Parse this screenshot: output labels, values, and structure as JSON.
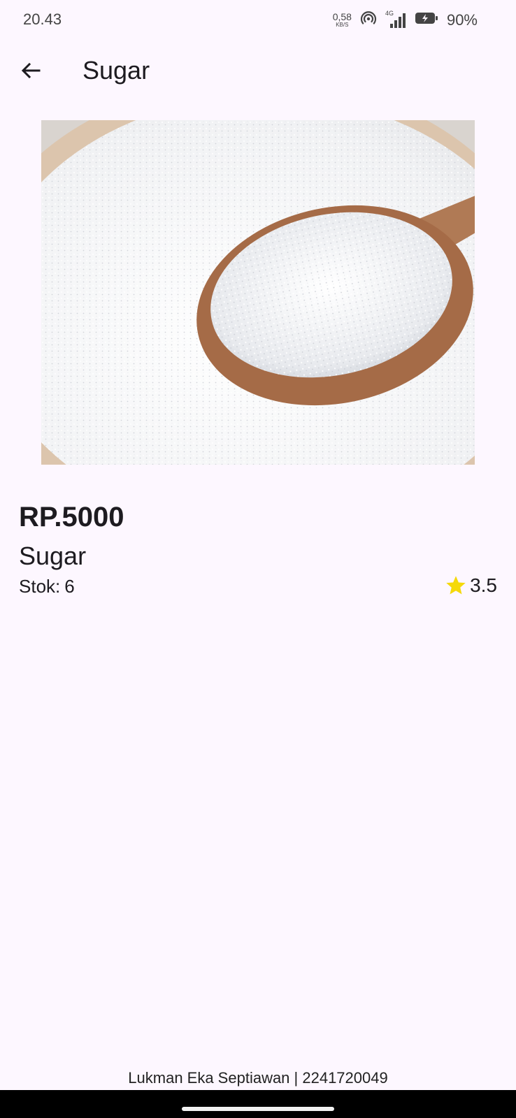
{
  "status_bar": {
    "time": "20.43",
    "net_speed_value": "0,58",
    "net_speed_unit": "KB/S",
    "network_type": "4G",
    "battery_percent": "90%"
  },
  "app_bar": {
    "title": "Sugar",
    "back_icon": "arrow-back-icon"
  },
  "product": {
    "image_alt": "sugar-photo",
    "price": "RP.5000",
    "name": "Sugar",
    "stock_label": "Stok:",
    "stock_value": "6",
    "rating_icon": "star-icon",
    "rating": "3.5"
  },
  "footer": {
    "credit": "Lukman Eka Septiawan | 2241720049"
  },
  "colors": {
    "background": "#fdf7ff",
    "text": "#1d1b20",
    "star": "#f5d90a",
    "nav_bar": "#000000"
  }
}
